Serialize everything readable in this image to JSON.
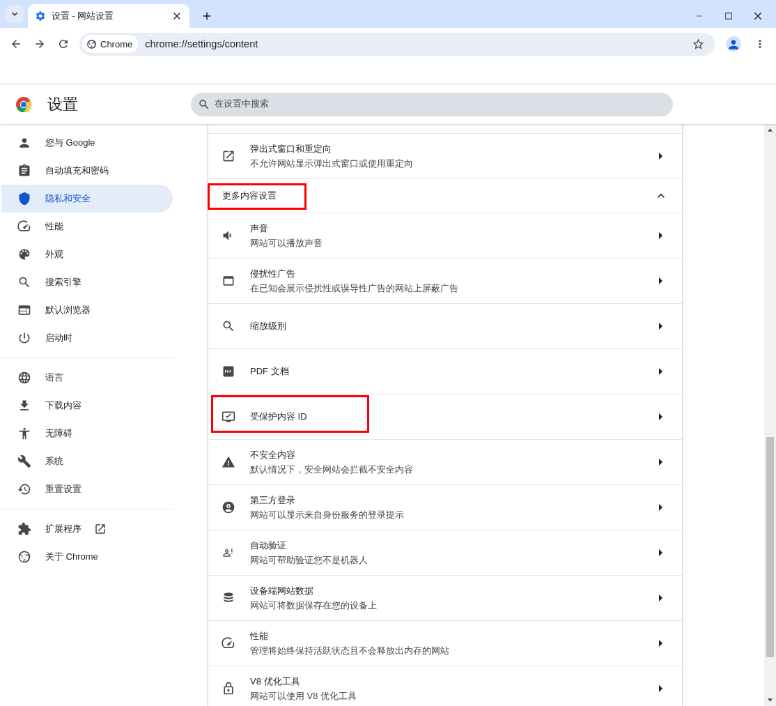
{
  "tab": {
    "title": "设置 - 网站设置",
    "selected": true
  },
  "address_bar": {
    "chip": "Chrome",
    "url": "chrome://settings/content"
  },
  "settings_header": {
    "title": "设置",
    "search": {
      "placeholder": "在设置中搜索"
    }
  },
  "sidebar": {
    "groups": [
      [
        {
          "label": "您与 Google",
          "selected": false
        },
        {
          "label": "自动填充和密码",
          "selected": false
        },
        {
          "label": "隐私和安全",
          "selected": true
        },
        {
          "label": "性能",
          "selected": false
        },
        {
          "label": "外观",
          "selected": false
        },
        {
          "label": "搜索引擎",
          "selected": false
        },
        {
          "label": "默认浏览器",
          "selected": false
        },
        {
          "label": "启动时",
          "selected": false
        }
      ],
      [
        {
          "label": "语言",
          "selected": false
        },
        {
          "label": "下载内容",
          "selected": false
        },
        {
          "label": "无障碍",
          "selected": false
        },
        {
          "label": "系统",
          "selected": false
        },
        {
          "label": "重置设置",
          "selected": false
        }
      ],
      [
        {
          "label": "扩展程序",
          "selected": false
        },
        {
          "label": "关于 Chrome",
          "selected": false
        }
      ]
    ]
  },
  "content": {
    "items": [
      {
        "kind": "row",
        "title": "弹出式窗口和重定向",
        "subtitle": "不允许网站显示弹出式窗口或使用重定向",
        "annotated": false
      },
      {
        "kind": "section",
        "title": "更多内容设置",
        "expanded": true,
        "annotated": true
      },
      {
        "kind": "row",
        "title": "声音",
        "subtitle": "网站可以播放声音",
        "annotated": false
      },
      {
        "kind": "row",
        "title": "侵扰性广告",
        "subtitle": "在已知会展示侵扰性或误导性广告的网站上屏蔽广告",
        "annotated": false
      },
      {
        "kind": "row",
        "title": "缩放级别",
        "annotated": false
      },
      {
        "kind": "row",
        "title": "PDF 文档",
        "annotated": false
      },
      {
        "kind": "row",
        "title": "受保护内容 ID",
        "annotated": true
      },
      {
        "kind": "row",
        "title": "不安全内容",
        "subtitle": "默认情况下，安全网站会拦截不安全内容",
        "annotated": false
      },
      {
        "kind": "row",
        "title": "第三方登录",
        "subtitle": "网站可以显示来自身份服务的登录提示",
        "annotated": false
      },
      {
        "kind": "row",
        "title": "自动验证",
        "subtitle": "网站可帮助验证您不是机器人",
        "annotated": false
      },
      {
        "kind": "row",
        "title": "设备端网站数据",
        "subtitle": "网站可将数据保存在您的设备上",
        "annotated": false
      },
      {
        "kind": "row",
        "title": "性能",
        "subtitle": "管理将始终保持活跃状态且不会释放出内存的网站",
        "annotated": false
      },
      {
        "kind": "row",
        "title": "V8 优化工具",
        "subtitle": "网站可以使用 V8 优化工具",
        "annotated": false
      }
    ]
  }
}
